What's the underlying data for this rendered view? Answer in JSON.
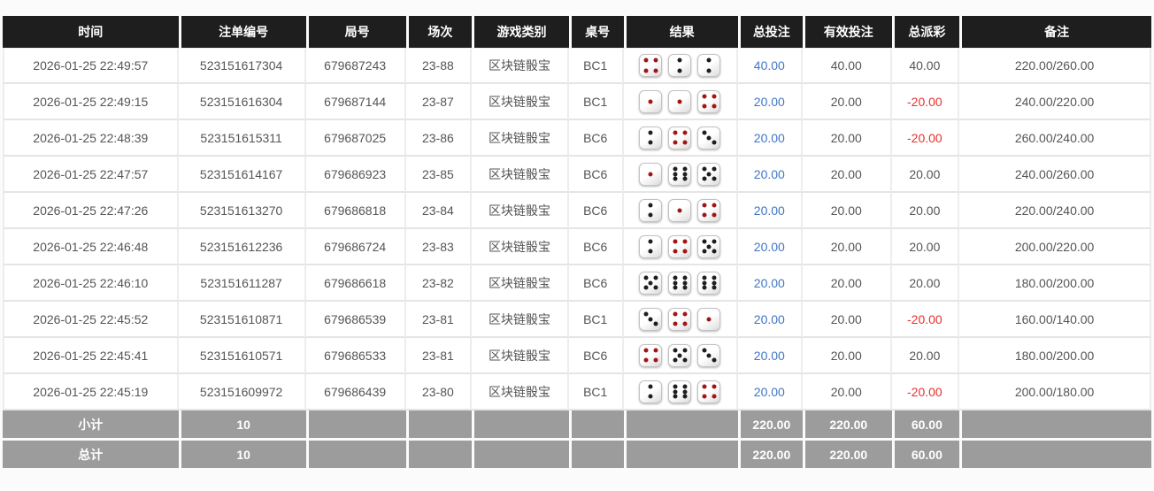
{
  "colors": {
    "header_bg": "#1e1e1e",
    "header_text": "#ffffff",
    "footer_bg": "#9c9c9c",
    "footer_text": "#ffffff",
    "bet_amount_blue": "#3e76c9",
    "negative_red": "#e8302e",
    "row_text": "#555555",
    "dice_pip_black": "#1e1e1e",
    "dice_pip_red": "#a31515"
  },
  "table": {
    "headers": [
      "时间",
      "注单编号",
      "局号",
      "场次",
      "游戏类别",
      "桌号",
      "结果",
      "总投注",
      "有效投注",
      "总派彩",
      "备注"
    ],
    "rows": [
      {
        "time": "2026-01-25 22:49:57",
        "bet_id": "523151617304",
        "round_id": "679687243",
        "session": "23-88",
        "game_type": "区块链骰宝",
        "table_no": "BC1",
        "dice": [
          4,
          2,
          2
        ],
        "total_bet": "40.00",
        "valid_bet": "40.00",
        "payout": "40.00",
        "remark": "220.00/260.00"
      },
      {
        "time": "2026-01-25 22:49:15",
        "bet_id": "523151616304",
        "round_id": "679687144",
        "session": "23-87",
        "game_type": "区块链骰宝",
        "table_no": "BC1",
        "dice": [
          1,
          1,
          4
        ],
        "total_bet": "20.00",
        "valid_bet": "20.00",
        "payout": "-20.00",
        "remark": "240.00/220.00"
      },
      {
        "time": "2026-01-25 22:48:39",
        "bet_id": "523151615311",
        "round_id": "679687025",
        "session": "23-86",
        "game_type": "区块链骰宝",
        "table_no": "BC6",
        "dice": [
          2,
          4,
          3
        ],
        "total_bet": "20.00",
        "valid_bet": "20.00",
        "payout": "-20.00",
        "remark": "260.00/240.00"
      },
      {
        "time": "2026-01-25 22:47:57",
        "bet_id": "523151614167",
        "round_id": "679686923",
        "session": "23-85",
        "game_type": "区块链骰宝",
        "table_no": "BC6",
        "dice": [
          1,
          6,
          5
        ],
        "total_bet": "20.00",
        "valid_bet": "20.00",
        "payout": "20.00",
        "remark": "240.00/260.00"
      },
      {
        "time": "2026-01-25 22:47:26",
        "bet_id": "523151613270",
        "round_id": "679686818",
        "session": "23-84",
        "game_type": "区块链骰宝",
        "table_no": "BC6",
        "dice": [
          2,
          1,
          4
        ],
        "total_bet": "20.00",
        "valid_bet": "20.00",
        "payout": "20.00",
        "remark": "220.00/240.00"
      },
      {
        "time": "2026-01-25 22:46:48",
        "bet_id": "523151612236",
        "round_id": "679686724",
        "session": "23-83",
        "game_type": "区块链骰宝",
        "table_no": "BC6",
        "dice": [
          2,
          4,
          5
        ],
        "total_bet": "20.00",
        "valid_bet": "20.00",
        "payout": "20.00",
        "remark": "200.00/220.00"
      },
      {
        "time": "2026-01-25 22:46:10",
        "bet_id": "523151611287",
        "round_id": "679686618",
        "session": "23-82",
        "game_type": "区块链骰宝",
        "table_no": "BC6",
        "dice": [
          5,
          6,
          6
        ],
        "total_bet": "20.00",
        "valid_bet": "20.00",
        "payout": "20.00",
        "remark": "180.00/200.00"
      },
      {
        "time": "2026-01-25 22:45:52",
        "bet_id": "523151610871",
        "round_id": "679686539",
        "session": "23-81",
        "game_type": "区块链骰宝",
        "table_no": "BC1",
        "dice": [
          3,
          4,
          1
        ],
        "total_bet": "20.00",
        "valid_bet": "20.00",
        "payout": "-20.00",
        "remark": "160.00/140.00"
      },
      {
        "time": "2026-01-25 22:45:41",
        "bet_id": "523151610571",
        "round_id": "679686533",
        "session": "23-81",
        "game_type": "区块链骰宝",
        "table_no": "BC6",
        "dice": [
          4,
          5,
          3
        ],
        "total_bet": "20.00",
        "valid_bet": "20.00",
        "payout": "20.00",
        "remark": "180.00/200.00"
      },
      {
        "time": "2026-01-25 22:45:19",
        "bet_id": "523151609972",
        "round_id": "679686439",
        "session": "23-80",
        "game_type": "区块链骰宝",
        "table_no": "BC1",
        "dice": [
          2,
          6,
          4
        ],
        "total_bet": "20.00",
        "valid_bet": "20.00",
        "payout": "-20.00",
        "remark": "200.00/180.00"
      }
    ],
    "footer_rows": [
      {
        "label": "小计",
        "count": "10",
        "total_bet": "220.00",
        "valid_bet": "220.00",
        "payout": "60.00"
      },
      {
        "label": "总计",
        "count": "10",
        "total_bet": "220.00",
        "valid_bet": "220.00",
        "payout": "60.00"
      }
    ]
  }
}
